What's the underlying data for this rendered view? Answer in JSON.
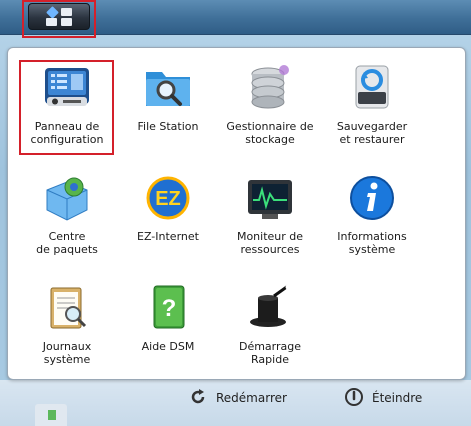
{
  "apps": [
    {
      "label_lines": [
        "Panneau de",
        "configuration"
      ],
      "icon": "control-panel-icon"
    },
    {
      "label_lines": [
        "File Station"
      ],
      "icon": "file-station-icon"
    },
    {
      "label_lines": [
        "Gestionnaire de",
        "stockage"
      ],
      "icon": "storage-manager-icon"
    },
    {
      "label_lines": [
        "Sauvegarder",
        "et restaurer"
      ],
      "icon": "backup-restore-icon"
    },
    {
      "label_lines": [
        "Centre",
        "de paquets"
      ],
      "icon": "package-center-icon"
    },
    {
      "label_lines": [
        "EZ-Internet"
      ],
      "icon": "ez-internet-icon"
    },
    {
      "label_lines": [
        "Moniteur de",
        "ressources"
      ],
      "icon": "resource-monitor-icon"
    },
    {
      "label_lines": [
        "Informations",
        "système"
      ],
      "icon": "system-info-icon"
    },
    {
      "label_lines": [
        "Journaux",
        "système"
      ],
      "icon": "system-logs-icon"
    },
    {
      "label_lines": [
        "Aide DSM"
      ],
      "icon": "dsm-help-icon"
    },
    {
      "label_lines": [
        "Démarrage",
        "Rapide"
      ],
      "icon": "quick-start-icon"
    }
  ],
  "footer": {
    "restart_label": "Redémarrer",
    "shutdown_label": "Éteindre"
  },
  "taskbar": {
    "main_menu_icon": "main-menu-icon"
  },
  "ez_badge": "EZ"
}
